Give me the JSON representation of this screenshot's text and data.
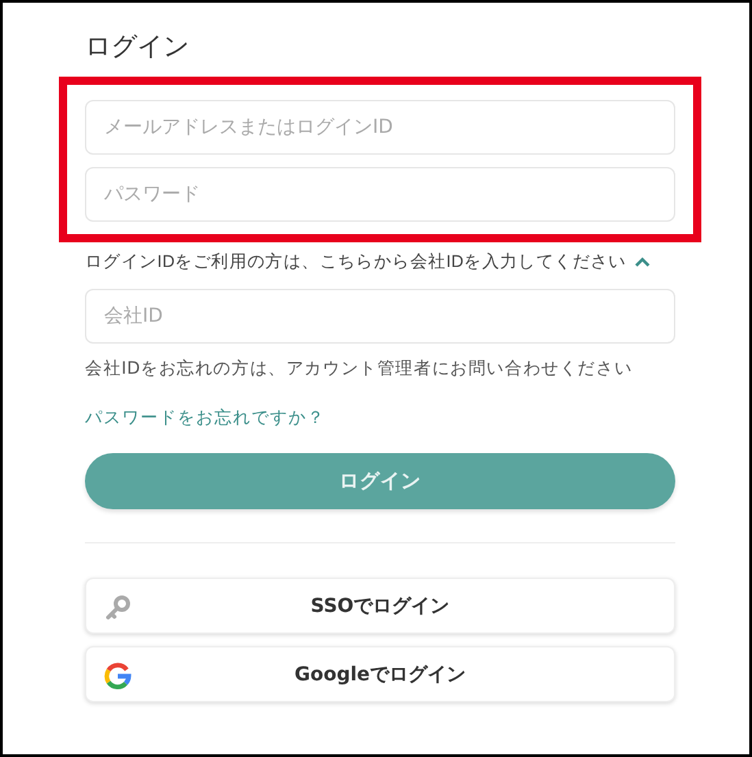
{
  "title": "ログイン",
  "credential_fields": [
    {
      "placeholder": "メールアドレスまたはログインID"
    },
    {
      "placeholder": "パスワード"
    }
  ],
  "company_toggle": {
    "label": "ログインIDをご利用の方は、こちらから会社IDを入力してください",
    "expanded": true
  },
  "company_field": {
    "placeholder": "会社ID"
  },
  "company_note": "会社IDをお忘れの方は、アカウント管理者にお問い合わせください",
  "forgot_link": "パスワードをお忘れですか？",
  "login_button": "ログイン",
  "alt_logins": [
    {
      "kind": "sso",
      "label": "SSOでログイン"
    },
    {
      "kind": "google",
      "label": "Googleでログイン"
    }
  ]
}
